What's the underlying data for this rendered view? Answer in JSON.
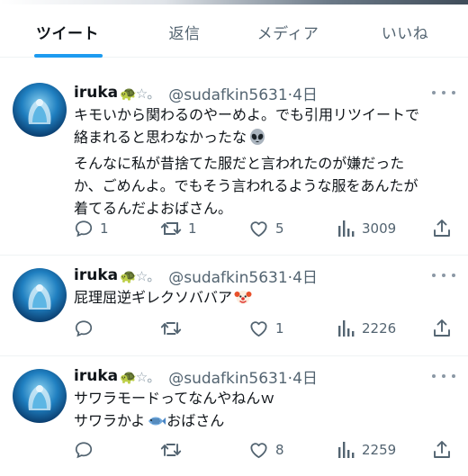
{
  "tabs": [
    {
      "label": "ツイート",
      "active": true
    },
    {
      "label": "返信",
      "active": false
    },
    {
      "label": "メディア",
      "active": false
    },
    {
      "label": "いいね",
      "active": false
    }
  ],
  "colors": {
    "accent": "#1d9bf0",
    "secondary_text": "#536471",
    "divider": "#eff3f4"
  },
  "tweets": [
    {
      "name": "iruka",
      "name_decor": "🐢☆。",
      "handle": "@sudafkin5631",
      "time": "4日",
      "lines": [
        "キモいから関わるのやーめよ。でも引用リツイートで",
        "絡まれると思わなかったな",
        "そんなに私が昔捨てた服だと言われたのが嫌だった",
        "か、ごめんよ。でもそう言われるような服をあんたが",
        "着てるんだよおばさん。"
      ],
      "emoji": "alien-emoji",
      "stats": {
        "replies": "1",
        "retweets": "1",
        "likes": "5",
        "views": "3009"
      }
    },
    {
      "name": "iruka",
      "name_decor": "🐢☆。",
      "handle": "@sudafkin5631",
      "time": "4日",
      "lines": [
        "屁理屈逆ギレクソババア"
      ],
      "emoji": "clown-emoji",
      "stats": {
        "replies": "",
        "retweets": "",
        "likes": "1",
        "views": "2226"
      }
    },
    {
      "name": "iruka",
      "name_decor": "🐢☆。",
      "handle": "@sudafkin5631",
      "time": "4日",
      "lines": [
        "サワラモードってなんやねんｗ",
        "サワラかよ",
        "おばさん"
      ],
      "emoji": "fish-emoji",
      "stats": {
        "replies": "",
        "retweets": "",
        "likes": "8",
        "views": "2259"
      }
    }
  ]
}
